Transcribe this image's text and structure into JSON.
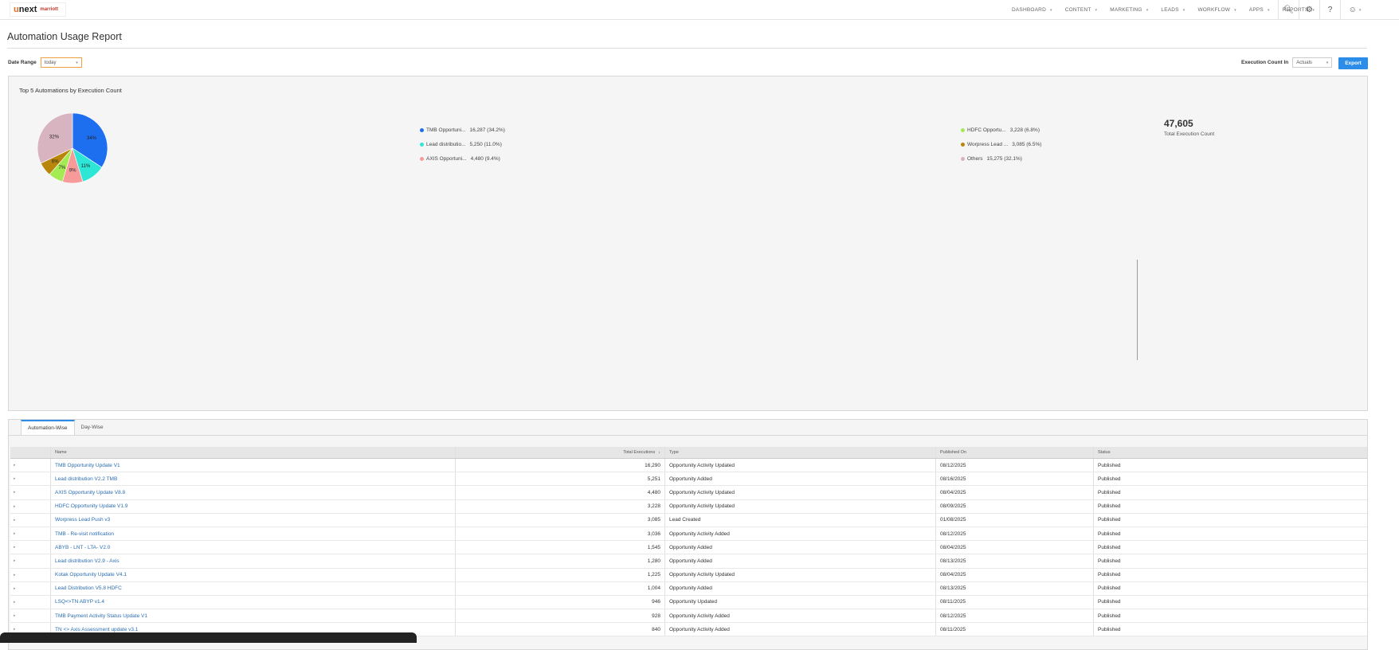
{
  "brand": {
    "logo_text": "unext",
    "logo_accent": "u",
    "partner_text": "marriott"
  },
  "nav": {
    "items": [
      {
        "label": "DASHBOARD"
      },
      {
        "label": "CONTENT"
      },
      {
        "label": "MARKETING"
      },
      {
        "label": "LEADS"
      },
      {
        "label": "WORKFLOW"
      },
      {
        "label": "APPS"
      },
      {
        "label": "REPORTS"
      }
    ],
    "icons": [
      "search-icon",
      "bug-icon",
      "help-icon",
      "user-icon"
    ]
  },
  "page": {
    "title": "Automation Usage Report"
  },
  "filters": {
    "date_range_label": "Date Range",
    "date_range_value": "today",
    "execution_count_label": "Execution Count In",
    "execution_count_value": "Actuals",
    "export_label": "Export"
  },
  "chart": {
    "title": "Top 5 Automations by Execution Count",
    "total_value": "47,605",
    "total_label": "Total Execution Count"
  },
  "chart_data": {
    "type": "pie",
    "title": "Top 5 Automations by Execution Count",
    "slices": [
      {
        "label": "TMB Opportuni...",
        "value": 16287,
        "pct_text": "16,287 (34.2%)",
        "slice_label": "34%",
        "color": "#1e6fef"
      },
      {
        "label": "Lead distributio...",
        "value": 5250,
        "pct_text": "5,250 (11.0%)",
        "slice_label": "11%",
        "color": "#2ee6d6"
      },
      {
        "label": "AXIS Opportuni...",
        "value": 4480,
        "pct_text": "4,480 (9.4%)",
        "slice_label": "9%",
        "color": "#f79a9a"
      },
      {
        "label": "HDFC Opportu...",
        "value": 3228,
        "pct_text": "3,228 (6.8%)",
        "slice_label": "7%",
        "color": "#a4ea52"
      },
      {
        "label": "Worpress Lead ...",
        "value": 3085,
        "pct_text": "3,085 (6.5%)",
        "slice_label": "6%",
        "color": "#b8860b"
      },
      {
        "label": "Others",
        "value": 15275,
        "pct_text": "15,275 (32.1%)",
        "slice_label": "32%",
        "color": "#d8b4c0"
      }
    ],
    "legend_placement": "right"
  },
  "tabs": [
    {
      "label": "Automation-Wise",
      "active": true
    },
    {
      "label": "Day-Wise",
      "active": false
    }
  ],
  "table": {
    "columns": [
      "Name",
      "Total Executions",
      "Type",
      "Published On",
      "Status"
    ],
    "rows": [
      {
        "name": "TMB Opportunity Update V1",
        "total": "16,290",
        "type": "Opportunity Activity Updated",
        "published": "08/12/2025",
        "status": "Published"
      },
      {
        "name": "Lead distribution V2.2 TMB",
        "total": "5,251",
        "type": "Opportunity Added",
        "published": "08/16/2025",
        "status": "Published"
      },
      {
        "name": "AXIS Opportunity Update V8.8",
        "total": "4,480",
        "type": "Opportunity Activity Updated",
        "published": "08/04/2025",
        "status": "Published"
      },
      {
        "name": "HDFC Opportunity Update V1.9",
        "total": "3,228",
        "type": "Opportunity Activity Updated",
        "published": "08/09/2025",
        "status": "Published"
      },
      {
        "name": "Worpress Lead Push v3",
        "total": "3,085",
        "type": "Lead Created",
        "published": "01/08/2025",
        "status": "Published"
      },
      {
        "name": "TMB - Re-visit notification",
        "total": "3,036",
        "type": "Opportunity Activity Added",
        "published": "08/12/2025",
        "status": "Published"
      },
      {
        "name": "ABYB - LNT - LTA- V2.0",
        "total": "1,545",
        "type": "Opportunity Added",
        "published": "08/04/2025",
        "status": "Published"
      },
      {
        "name": "Lead distribution V2.9 - Axis",
        "total": "1,280",
        "type": "Opportunity Added",
        "published": "08/13/2025",
        "status": "Published"
      },
      {
        "name": "Kotak Opportunity Update V4.1",
        "total": "1,225",
        "type": "Opportunity Activity Updated",
        "published": "08/04/2025",
        "status": "Published"
      },
      {
        "name": "Lead Distribution V5.8 HDFC",
        "total": "1,004",
        "type": "Opportunity Added",
        "published": "08/13/2025",
        "status": "Published"
      },
      {
        "name": "LSQ<>TN ABYP v1.4",
        "total": "946",
        "type": "Opportunity Updated",
        "published": "08/11/2025",
        "status": "Published"
      },
      {
        "name": "TMB Payment Activity Status Update V1",
        "total": "928",
        "type": "Opportunity Activity Added",
        "published": "08/12/2025",
        "status": "Published"
      },
      {
        "name": "TN <> Axis Assessment update v3.1",
        "total": "840",
        "type": "Opportunity Activity Added",
        "published": "08/11/2025",
        "status": "Published"
      }
    ]
  }
}
